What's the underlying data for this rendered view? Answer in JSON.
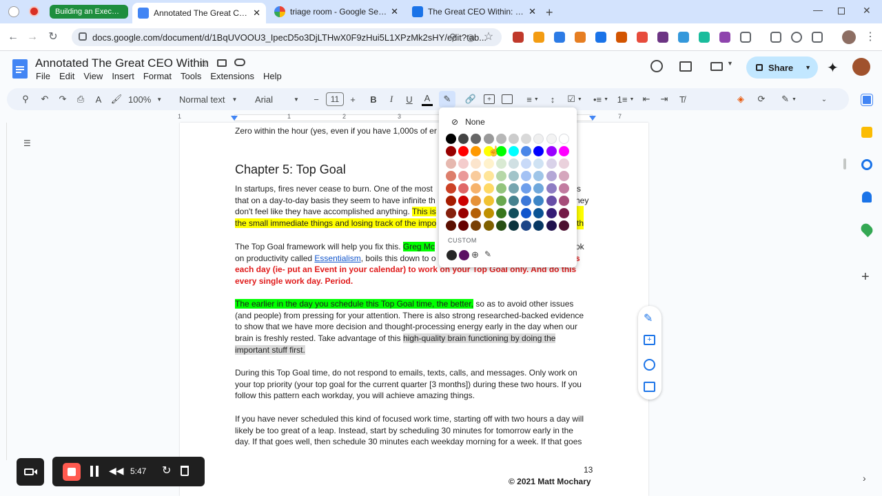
{
  "browser": {
    "tabs": [
      {
        "label": "Building an Executive",
        "active": false
      },
      {
        "label": "Annotated The Great CEO With",
        "active": true
      },
      {
        "label": "triage room - Google Search",
        "active": false
      },
      {
        "label": "The Great CEO Within: Chapter",
        "active": false
      }
    ],
    "url": "docs.google.com/document/d/1BqUVOOU3_IpecD5o3DjLTHwX0F9zHui5L1XPzMk2sHY/edit?tab..."
  },
  "doc": {
    "title": "Annotated The Great CEO Within",
    "menu": [
      "File",
      "Edit",
      "View",
      "Insert",
      "Format",
      "Tools",
      "Extensions",
      "Help"
    ],
    "share_label": "Share"
  },
  "toolbar": {
    "zoom": "100%",
    "style": "Normal text",
    "font": "Arial",
    "font_size": "11"
  },
  "ruler": {
    "ticks": [
      "1",
      "1",
      "2",
      "3",
      "4",
      "5",
      "6",
      "7"
    ]
  },
  "color_picker": {
    "none_label": "None",
    "custom_label": "CUSTOM",
    "row0": [
      "#000000",
      "#434343",
      "#666666",
      "#999999",
      "#b7b7b7",
      "#cccccc",
      "#d9d9d9",
      "#efefef",
      "#f3f3f3",
      "#ffffff"
    ],
    "row1": [
      "#980000",
      "#ff0000",
      "#ff9900",
      "#ffff00",
      "#00ff00",
      "#00ffff",
      "#4a86e8",
      "#0000ff",
      "#9900ff",
      "#ff00ff"
    ],
    "row2": [
      "#e6b8af",
      "#f4cccc",
      "#fce5cd",
      "#fff2cc",
      "#d9ead3",
      "#d0e0e3",
      "#c9daf8",
      "#cfe2f3",
      "#d9d2e9",
      "#ead1dc"
    ],
    "row3": [
      "#dd7e6b",
      "#ea9999",
      "#f9cb9c",
      "#ffe599",
      "#b6d7a8",
      "#a2c4c9",
      "#a4c2f4",
      "#9fc5e8",
      "#b4a7d6",
      "#d5a6bd"
    ],
    "row4": [
      "#cc4125",
      "#e06666",
      "#f6b26b",
      "#ffd966",
      "#93c47d",
      "#76a5af",
      "#6d9eeb",
      "#6fa8dc",
      "#8e7cc3",
      "#c27ba0"
    ],
    "row5": [
      "#a61c00",
      "#cc0000",
      "#e69138",
      "#f1c232",
      "#6aa84f",
      "#45818e",
      "#3c78d8",
      "#3d85c6",
      "#674ea7",
      "#a64d79"
    ],
    "row6": [
      "#85200c",
      "#990000",
      "#b45f06",
      "#bf9000",
      "#38761d",
      "#134f5c",
      "#1155cc",
      "#0b5394",
      "#351c75",
      "#741b47"
    ],
    "row7": [
      "#5b0f00",
      "#660000",
      "#783f04",
      "#7f6000",
      "#274e13",
      "#0c343d",
      "#1c4587",
      "#073763",
      "#20124d",
      "#4c1130"
    ],
    "custom": [
      "#262626",
      "#5b1063"
    ]
  },
  "body": {
    "line0": "Zero within the hour (yes, even if you have 1,000s of er",
    "heading": "Chapter 5: Top Goal",
    "p1a": "In startups, fires never cease to burn. One of the most",
    "p1a_end": "s is",
    "p1b": "that on a day-to-day basis they seem to have infinite th",
    "p1b_end": "hey",
    "p1c": "don't feel like they have accomplished anything.",
    "p1c_hl": "This is",
    "p1d_hl": "the small immediate things and losing track of the impo",
    "p1d_end": "th",
    "p2a": "The Top Goal framework will help you fix this.",
    "p2a_hl": "Greg Mc",
    "p2a_end": "ok",
    "p2b": "on productivity called",
    "p2b_link": "Essentialism",
    "p2b_rest": ", boils this down to o",
    "p2b_end": "s",
    "p2c": "each day (ie- put an Event in your calendar) to work on your Top Goal only. And do this",
    "p2d": "every single work day. Period.",
    "p3a_hl": "The earlier in the day you schedule this Top Goal time, the better,",
    "p3a_rest": " so as to avoid other issues",
    "p3b": "(and people) from pressing for your attention.  There is also strong researched-backed evidence",
    "p3c": "to show that we have more decision and thought-processing energy early in the day when our",
    "p3d": "brain is freshly rested.  Take advantage of this",
    "p3d_hl": "high-quality brain functioning by doing the",
    "p3e_hl": "important stuff first.",
    "p4a": "During this Top Goal time, do not respond to emails, texts, calls, and messages.  Only work on",
    "p4b": "your top priority (your top goal for the current quarter [3 months]) during these two hours.  If you",
    "p4c": "follow this pattern each workday, you will achieve amazing things.",
    "p5a": "If you have never scheduled this kind of focused work time, starting off with two hours a day will",
    "p5b": "likely be too great of a leap.  Instead, start by scheduling 30 minutes for tomorrow early in the",
    "p5c": "day.  If that goes well, then schedule 30 minutes each weekday morning for a week.  If that goes",
    "page_number": "13",
    "footer": "© 2021 Matt Mochary"
  },
  "recorder": {
    "time": "5:47"
  }
}
